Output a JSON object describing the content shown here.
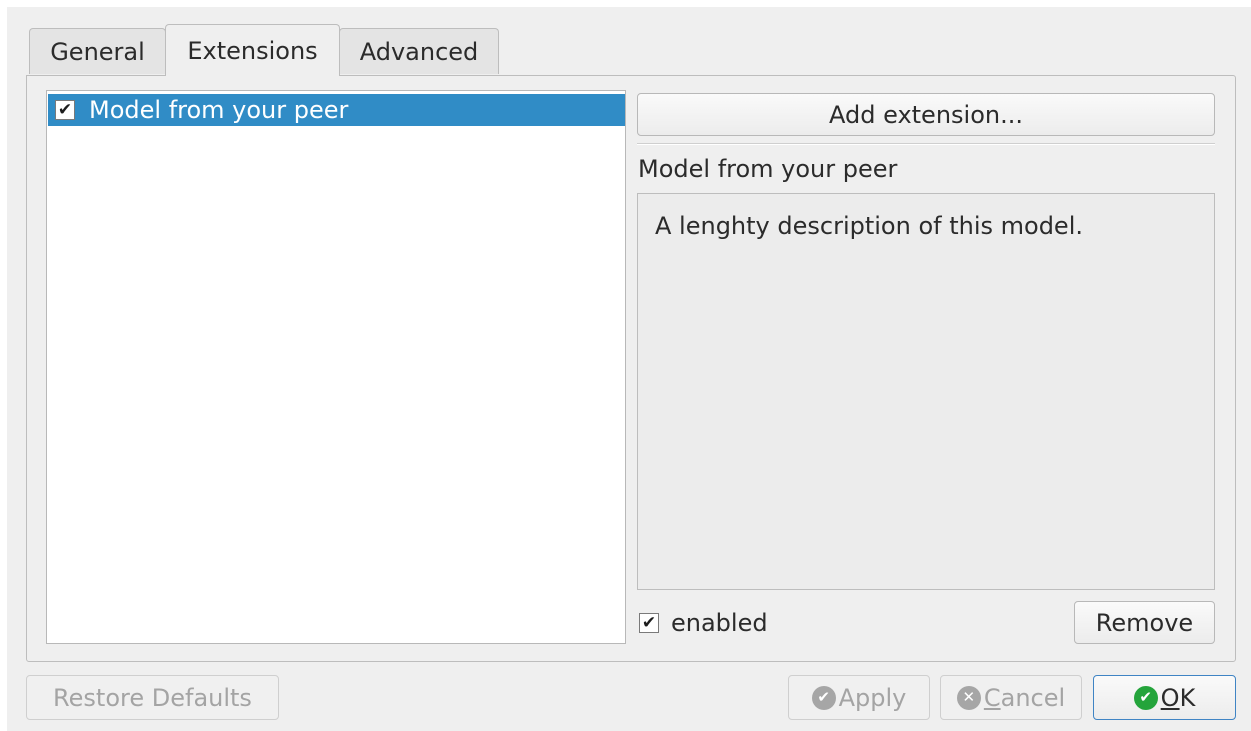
{
  "tabs": [
    {
      "label": "General"
    },
    {
      "label": "Extensions"
    },
    {
      "label": "Advanced"
    }
  ],
  "active_tab": "Extensions",
  "extensions_list": [
    {
      "label": "Model from your peer",
      "checked": true,
      "selected": true
    }
  ],
  "details": {
    "add_button_label": "Add extension...",
    "name": "Model from your peer",
    "description": "A lenghty description of this model.",
    "enabled_label": "enabled",
    "enabled": true,
    "remove_label": "Remove"
  },
  "footer": {
    "restore_label": "Restore Defaults",
    "apply_label": "Apply",
    "cancel_label": "Cancel",
    "ok_label": "OK"
  },
  "colors": {
    "selection": "#308cc6",
    "ok_icon": "#24a43b",
    "disabled_text": "#a4a4a4"
  },
  "icons": {
    "list_check": "checkmark",
    "apply": "check-circle-icon",
    "cancel": "x-circle-icon",
    "ok": "check-circle-icon"
  }
}
